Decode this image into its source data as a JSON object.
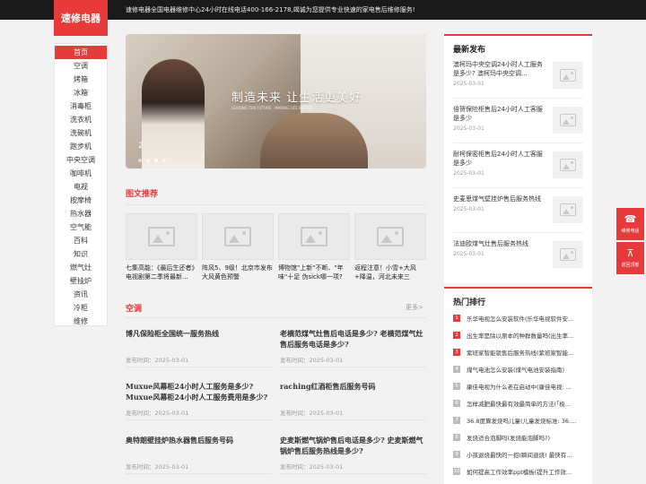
{
  "header": {
    "logo": "速修电器",
    "notice": "速修电器全国电器维修中心24小时在线电话400-166-2178,竭诚为您提供专业快速的家电售后维修服务!"
  },
  "nav": [
    "首页",
    "空调",
    "烤箱",
    "冰箱",
    "消毒柜",
    "洗衣机",
    "洗碗机",
    "跑步机",
    "中央空调",
    "咖啡机",
    "电视",
    "按摩椅",
    "热水器",
    "空气能",
    "百科",
    "知识",
    "燃气灶",
    "壁挂炉",
    "资讯",
    "冷柜",
    "维修"
  ],
  "banner": {
    "slogan": "制造未来 让生活更美好",
    "sub": "LEADING THE FUTURE · MAKING LIFE BETTER",
    "index": "2",
    "dots": 4,
    "active_dot": 2
  },
  "recommend": {
    "title": "图文推荐",
    "items": [
      "七集高能：《最后生还者》电视剧第二季将最新...",
      "阵风5、9级！北京市发布大风黄色预警",
      "博物馆\"上新\"不断、\"年味\"十足 伪sick哪一项?",
      "返程注意！小雪+大风+降温，河北未来三天......"
    ]
  },
  "aircon": {
    "title": "空调",
    "more": "更多>",
    "articles": [
      {
        "title": "博凡保险柜全国统一服务热线",
        "date": "发布时间：2025-03-01"
      },
      {
        "title": "老横范煤气灶售后电话是多少? 老横范煤气灶售后服务电话是多少?",
        "date": "发布时间：2025-03-01"
      },
      {
        "title": "Muxue风幕柜24小时人工服务是多少? Muxue风幕柜24小时人工服务费用是多少?",
        "date": "发布时间：2025-03-01"
      },
      {
        "title": "raching红酒柜售后服务号码",
        "date": "发布时间：2025-03-01"
      },
      {
        "title": "奥特朗壁挂炉热水器售后服务号码",
        "date": "发布时间：2025-03-01"
      },
      {
        "title": "史麦斯燃气锅炉售后电话是多少? 史麦斯燃气锅炉售后服务热线是多少?",
        "date": "发布时间：2025-03-01"
      }
    ]
  },
  "latest": {
    "title": "最新发布",
    "items": [
      {
        "title": "澳柯玛中央空调24小时人工服务是多少? 澳柯玛中央空调...",
        "date": "2025-03-01"
      },
      {
        "title": "倍贺保险柜售后24小时人工客服是多少",
        "date": "2025-03-01"
      },
      {
        "title": "耐柯保密柜售后24小时人工客服是多少",
        "date": "2025-03-01"
      },
      {
        "title": "史麦思煤气壁挂炉售后服务热线",
        "date": "2025-03-01"
      },
      {
        "title": "法迪欧煤气灶售后服务热线",
        "date": "2025-03-01"
      }
    ]
  },
  "hot": {
    "title": "热门排行",
    "items": [
      "乐华电视怎么安装软件(乐华电视软件安...",
      "出生率是除以原本的种群数量吗(出生率...",
      "紫班家智能锁售后服务热线(紫班家智能...",
      "煤气电池怎么安装(煤气电池安装指南)",
      "康佳电视为什么老在启动中(康佳电视: ...",
      "怎样减肥最快最有效最简单的方法(「极...",
      "36.8度算发烧吗儿童(儿童发烧标准: 36....",
      "发烧适合泡脚吗(发烧能泡脚吗?)",
      "小孩退烧最快的一招(瞬间退烧! 最快有...",
      "如何提高工作效率ppt模板(提升工作效..."
    ]
  },
  "float": {
    "phone_label": "维修电话",
    "top_label": "返回顶部"
  }
}
